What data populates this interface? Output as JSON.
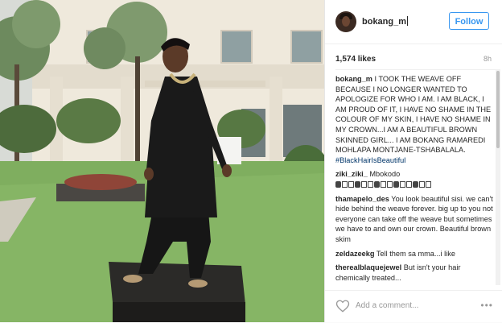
{
  "post": {
    "username": "bokang_m",
    "follow_label": "Follow",
    "likes": "1,574 likes",
    "time": "8h",
    "add_comment_placeholder": "Add a comment...",
    "more_label": "•••"
  },
  "caption": {
    "author": "bokang_m",
    "text": "I TOOK THE WEAVE OFF BECAUSE I NO LONGER WANTED TO APOLOGIZE FOR WHO I AM. I AM BLACK, I AM PROUD OF IT, I HAVE NO SHAME IN THE COLOUR OF MY SKIN, I HAVE NO SHAME IN MY CROWN...I AM A BEAUTIFUL BROWN SKINNED GIRL... I AM BOKANG RAMAREDI MOHLAPA MONTJANE-TSHABALALA.",
    "hashtag": "#BlackHairIsBeautiful"
  },
  "comments": [
    {
      "author": "ziki_ziki_",
      "text": "Mbokodo"
    },
    {
      "author": "thamapelo_des",
      "text": "You look beautiful sisi. we can't hide behind the weave forever. big up to you not everyone can take off the weave but sometimes we have to and own our crown. Beautiful brown skim"
    },
    {
      "author": "zeldazeekg",
      "text": "Tell them sa mma...i like"
    },
    {
      "author": "therealblaquejewel",
      "text": "But isn't your hair chemically treated..."
    }
  ],
  "colors": {
    "accent": "#3897f0",
    "hashtag": "#003569",
    "text": "#262626",
    "muted": "#999999"
  },
  "icons": {
    "heart": "heart-outline-icon",
    "more": "more-options-icon"
  }
}
